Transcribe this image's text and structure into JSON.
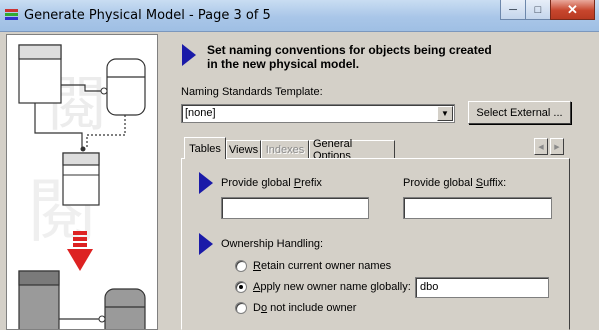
{
  "window": {
    "title": "Generate Physical Model - Page 3 of 5",
    "minimize_icon": "minimize-icon",
    "maximize_icon": "maximize-icon",
    "close_icon": "close-icon"
  },
  "header": {
    "line1": "Set naming conventions for objects being created",
    "line2": "in the new physical model."
  },
  "naming_template": {
    "label": "Naming Standards Template:",
    "value": "[none]",
    "select_external_label": "Select External ..."
  },
  "tabs": [
    {
      "label": "Tables",
      "active": true,
      "enabled": true
    },
    {
      "label": "Views",
      "active": false,
      "enabled": true
    },
    {
      "label": "Indexes",
      "active": false,
      "enabled": false
    },
    {
      "label": "General Options",
      "active": false,
      "enabled": true
    }
  ],
  "prefix": {
    "label_pre": "Provide global ",
    "label_u": "P",
    "label_post": "refix",
    "value": ""
  },
  "suffix": {
    "label_pre": "Provide global ",
    "label_u": "S",
    "label_post": "uffix:",
    "value": ""
  },
  "ownership": {
    "label": "Ownership Handling:",
    "options": [
      {
        "u": "R",
        "rest": "etain current owner names",
        "selected": false
      },
      {
        "u": "A",
        "rest": "pply new owner name globally:",
        "selected": true
      },
      {
        "pre": "D",
        "u": "o",
        "rest": " not include owner",
        "selected": false
      }
    ],
    "owner_name_value": "dbo"
  },
  "colors": {
    "accent_arrow": "#1a1aa8",
    "title_bar": "#a9c6e8",
    "close_button": "#c7462d"
  }
}
